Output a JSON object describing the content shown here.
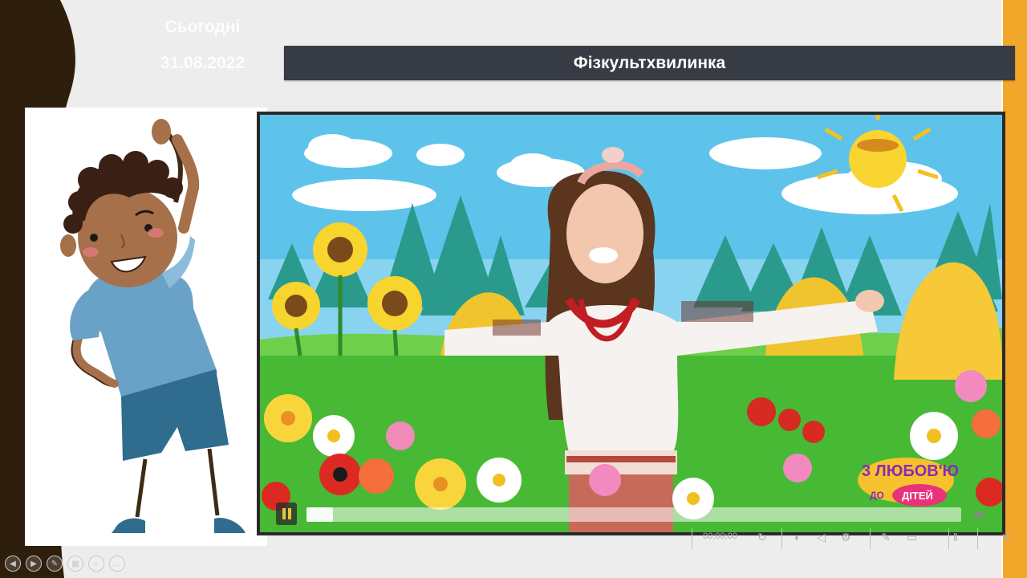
{
  "slide": {
    "today_label": "Сьогодні",
    "date": "31.08.2022",
    "title": "Фізкультхвилинка"
  },
  "video": {
    "logo_text_top": "3 ЛЮБОВ'Ю",
    "logo_text_bottom": "ДІТЕЙ",
    "logo_text_do": "ДО",
    "progress": 0.04,
    "status_label": "00:00:00"
  },
  "nav": {
    "buttons": [
      "prev-icon",
      "next-icon",
      "pen-icon",
      "slides-icon",
      "zoom-icon",
      "more-icon"
    ]
  },
  "colors": {
    "title_bar": "#373b44",
    "accent_orange": "#f2a72a",
    "left_band": "#2e1f0c"
  }
}
